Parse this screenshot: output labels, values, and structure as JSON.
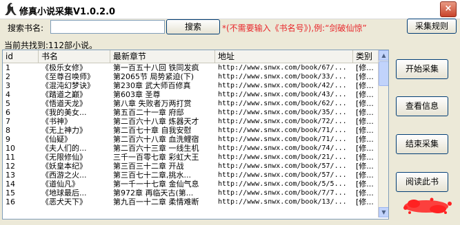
{
  "window": {
    "title": "修真小说采集V1.0.2.0",
    "close_glyph": "×"
  },
  "search": {
    "label": "搜索书名:",
    "value": "",
    "placeholder": "",
    "button": "搜索",
    "hint": "*(不需要输入《书名号》),例:“剑破仙惊”",
    "rules_button": "采集规则"
  },
  "status": {
    "count_text": "当前共找到:112部小说。"
  },
  "table": {
    "columns": [
      "id",
      "书名",
      "最新章节",
      "地址",
      "类别"
    ],
    "rows": [
      [
        "1",
        "《极乐女修》",
        "第一百五十八回 铁同发疯",
        "http://www.snwx.com/book/67/...",
        "[修..."
      ],
      [
        "2",
        "《至尊召唤师》",
        "第2065节 局势紧迫(下)",
        "http://www.snwx.com/book/33/...",
        "[修..."
      ],
      [
        "3",
        "《混沌幻梦诀》",
        "第230章 武大师百修真",
        "http://www.snwx.com/book/42/...",
        "[修..."
      ],
      [
        "4",
        "《踏道之巅》",
        "第603章 圣尊",
        "http://www.snwx.com/book/43/...",
        "[修..."
      ],
      [
        "5",
        "《悟道天龙》",
        "第八章 失败者万两打赏",
        "http://www.snwx.com/book/62/...",
        "[修..."
      ],
      [
        "6",
        "《我的美女...",
        "第五百二十一章 府邸",
        "http://www.snwx.com/book/35/...",
        "[修..."
      ],
      [
        "7",
        "《书神》",
        "第二百六十八章 炼器天才",
        "http://www.snwx.com/book/72/...",
        "[修..."
      ],
      [
        "8",
        "《无上神力》",
        "第二百七十章 自我安慰",
        "http://www.snwx.com/book/71/...",
        "[修..."
      ],
      [
        "9",
        "《仙疑》",
        "第二百六十八章 血洗鲤宿",
        "http://www.snwx.com/book/71/...",
        "[修..."
      ],
      [
        "10",
        "《夫人们的...",
        "第二百六十三章 一线生机",
        "http://www.snwx.com/book/74/...",
        "[修..."
      ],
      [
        "11",
        "《无限修仙》",
        "三千一百零七章 彩虹大王",
        "http://www.snwx.com/book/21/...",
        "[修..."
      ],
      [
        "12",
        "《妖皇本纪》",
        "第三百三十二章 开战",
        "http://www.snwx.com/book/57/...",
        "[修..."
      ],
      [
        "13",
        "《西游之火...",
        "第三百七十二章,挑水...",
        "http://www.snwx.com/book/57/...",
        "[修..."
      ],
      [
        "14",
        "《道仙凡》",
        "第一千一十七章 金仙气息",
        "http://www.snwx.com/book/5/5...",
        "[修..."
      ],
      [
        "15",
        "《地球最后...",
        "第972章 再临天古(第...",
        "http://www.snwx.com/book/7/7...",
        "[修..."
      ],
      [
        "16",
        "《恶犬天下》",
        "第九百一十二章 柔情难断",
        "http://www.snwx.com/book/13/...",
        "[修..."
      ]
    ]
  },
  "side_buttons": [
    "开始采集",
    "查看信息",
    "结束采集",
    "阅读此书"
  ],
  "colors": {
    "hint": "#e8262a",
    "stamp": "#ff2222",
    "close": "#c8432b"
  }
}
